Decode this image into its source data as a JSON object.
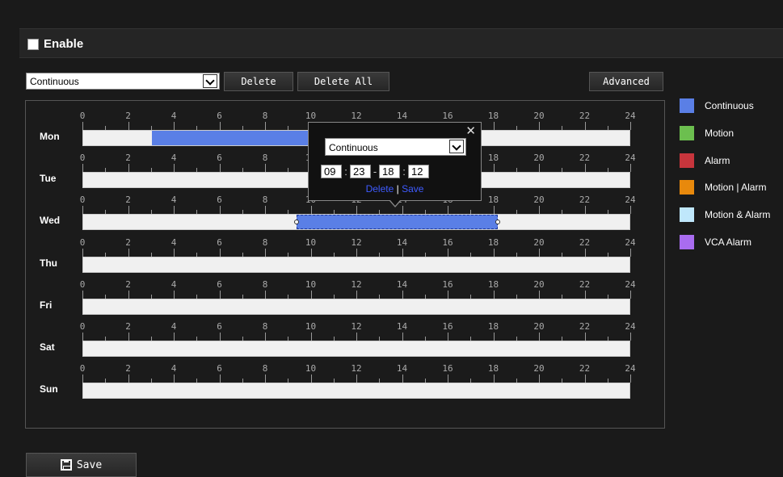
{
  "enable": {
    "label": "Enable",
    "checked": false
  },
  "toolbar": {
    "schedule_type": "Continuous",
    "delete_label": "Delete",
    "delete_all_label": "Delete All",
    "advanced_label": "Advanced"
  },
  "axis_ticks": [
    "0",
    "2",
    "4",
    "6",
    "8",
    "10",
    "12",
    "14",
    "16",
    "18",
    "20",
    "22",
    "24"
  ],
  "days": [
    {
      "label": "Mon",
      "segments": [
        {
          "start": 3,
          "end": 9.9,
          "type": "Continuous",
          "selected": false
        }
      ]
    },
    {
      "label": "Tue",
      "segments": []
    },
    {
      "label": "Wed",
      "segments": [
        {
          "start": 9.38,
          "end": 18.2,
          "type": "Continuous",
          "selected": true
        }
      ]
    },
    {
      "label": "Thu",
      "segments": []
    },
    {
      "label": "Fri",
      "segments": []
    },
    {
      "label": "Sat",
      "segments": []
    },
    {
      "label": "Sun",
      "segments": []
    }
  ],
  "popup": {
    "type": "Continuous",
    "start_hour": "09",
    "start_min": "23",
    "end_hour": "18",
    "end_min": "12",
    "colon": ":",
    "dash": "-",
    "delete_label": "Delete",
    "divider": "|",
    "save_label": "Save",
    "close_glyph": "✕"
  },
  "legend": [
    {
      "label": "Continuous",
      "color": "#5a7fe6"
    },
    {
      "label": "Motion",
      "color": "#6cbf4f"
    },
    {
      "label": "Alarm",
      "color": "#c7353c"
    },
    {
      "label": "Motion | Alarm",
      "color": "#e8890c"
    },
    {
      "label": "Motion & Alarm",
      "color": "#bfe7fb"
    },
    {
      "label": "VCA Alarm",
      "color": "#a96cf0"
    }
  ],
  "save_label": "Save"
}
